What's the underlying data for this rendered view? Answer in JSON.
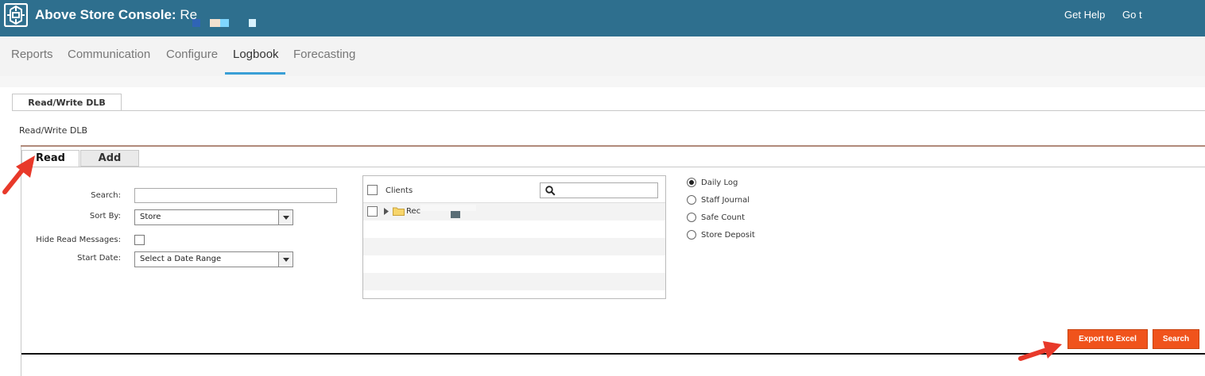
{
  "header": {
    "app_title": "Above Store Console:",
    "app_title_suffix": "Re",
    "get_help": "Get Help",
    "go_to": "Go t"
  },
  "nav": {
    "items": [
      {
        "label": "Reports"
      },
      {
        "label": "Communication"
      },
      {
        "label": "Configure"
      },
      {
        "label": "Logbook",
        "active": true
      },
      {
        "label": "Forecasting"
      }
    ]
  },
  "panel": {
    "outer_tab": "Read/Write DLB",
    "title": "Read/Write DLB",
    "subtabs": [
      {
        "label": "Read",
        "active": true
      },
      {
        "label": "Add"
      }
    ]
  },
  "form": {
    "search_label": "Search:",
    "search_value": "",
    "sort_by_label": "Sort By:",
    "sort_by_value": "Store",
    "hide_read_label": "Hide Read Messages:",
    "hide_read_checked": false,
    "start_date_label": "Start Date:",
    "start_date_value": "Select a Date Range"
  },
  "tree": {
    "header_label": "Clients",
    "search_value": "",
    "first_item_label": "Rec"
  },
  "log_types": {
    "options": [
      {
        "label": "Daily Log",
        "selected": true
      },
      {
        "label": "Staff Journal",
        "selected": false
      },
      {
        "label": "Safe Count",
        "selected": false
      },
      {
        "label": "Store Deposit",
        "selected": false
      }
    ]
  },
  "actions": {
    "export_label": "Export to Excel",
    "search_label": "Search"
  },
  "colors": {
    "header_bg": "#2e6f8e",
    "nav_active_underline": "#3a9fd6",
    "button_orange": "#f0531c",
    "annotation_red": "#e8392a"
  },
  "icons": [
    "logo-icon",
    "search-icon",
    "expand-arrow-icon",
    "folder-icon",
    "dropdown-arrow-icon"
  ]
}
